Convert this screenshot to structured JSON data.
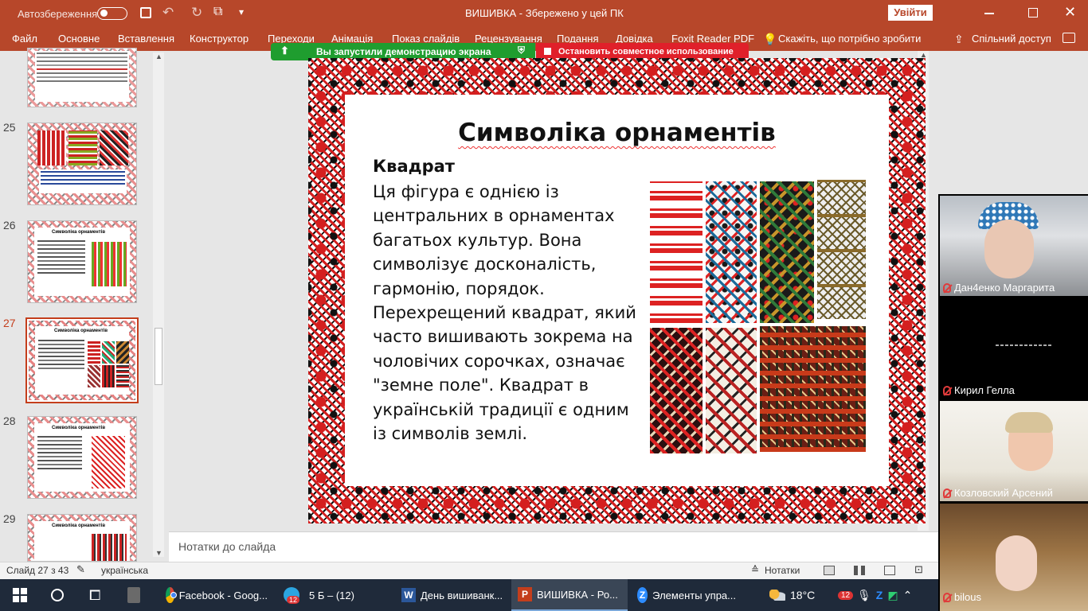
{
  "titlebar": {
    "autosave_label": "Автозбереження",
    "autosave_toggle": "off",
    "doc_title": "ВИШИВКА  -  Збережено у цей ПК",
    "signin_label": "Увійти"
  },
  "menu": {
    "items": [
      "Файл",
      "Основне",
      "Вставлення",
      "Конструктор",
      "Переходи",
      "Анімація",
      "Показ слайдів",
      "Рецензування",
      "Подання",
      "Довідка",
      "Foxit Reader PDF",
      "Скажіть, що потрібно зробити",
      "Спільний доступ"
    ]
  },
  "share_bar": {
    "status_label": "Вы запустили демонстрацию экрана",
    "stop_label": "Остановить совместное использование"
  },
  "thumbnails": [
    {
      "num": "25",
      "title": ""
    },
    {
      "num": "26",
      "title": "Символіка орнаментів"
    },
    {
      "num": "27",
      "title": "Символіка орнаментів"
    },
    {
      "num": "28",
      "title": "Символіка орнаментів"
    },
    {
      "num": "29",
      "title": "Символіка орнаментів"
    }
  ],
  "slide": {
    "title": "Символіка орнаментів",
    "heading": "Квадрат",
    "body": "Ця фігура є однією із центральних в орнаментах багатьох культур. Вона символізує досконалість, гармонію, порядок. Перехрещений квадрат, який часто вишивають зокрема на чоловічих сорочках, означає \"земне поле\". Квадрат в українській традиції є одним із символів землі."
  },
  "notes": {
    "placeholder": "Нотатки до слайда"
  },
  "statusbar": {
    "slide_info": "Слайд 27 з 43",
    "language": "українська",
    "notes_label": "Нотатки"
  },
  "taskbar": {
    "apps": [
      {
        "label": "Facebook - Goog...",
        "icon": "chrome-icon"
      },
      {
        "label": "5 Б – (12)",
        "icon": "telegram-icon",
        "badge": "12"
      },
      {
        "label": "День вишиванк...",
        "icon": "word-icon"
      },
      {
        "label": "ВИШИВКА - Ро...",
        "icon": "powerpoint-icon"
      },
      {
        "label": "Элементы упра...",
        "icon": "zoom-icon"
      }
    ],
    "weather": "18°C",
    "tray_badge": "12"
  },
  "participants": [
    {
      "name": "Дан4енко Маргарита"
    },
    {
      "name": "Кирил Гелла"
    },
    {
      "name": "Козловский Арсений"
    },
    {
      "name": "bilous"
    }
  ],
  "colors": {
    "accent": "#b7472a",
    "share_green": "#1f9d2f",
    "share_red": "#e0202a",
    "ornament_red": "#d41f1f"
  }
}
